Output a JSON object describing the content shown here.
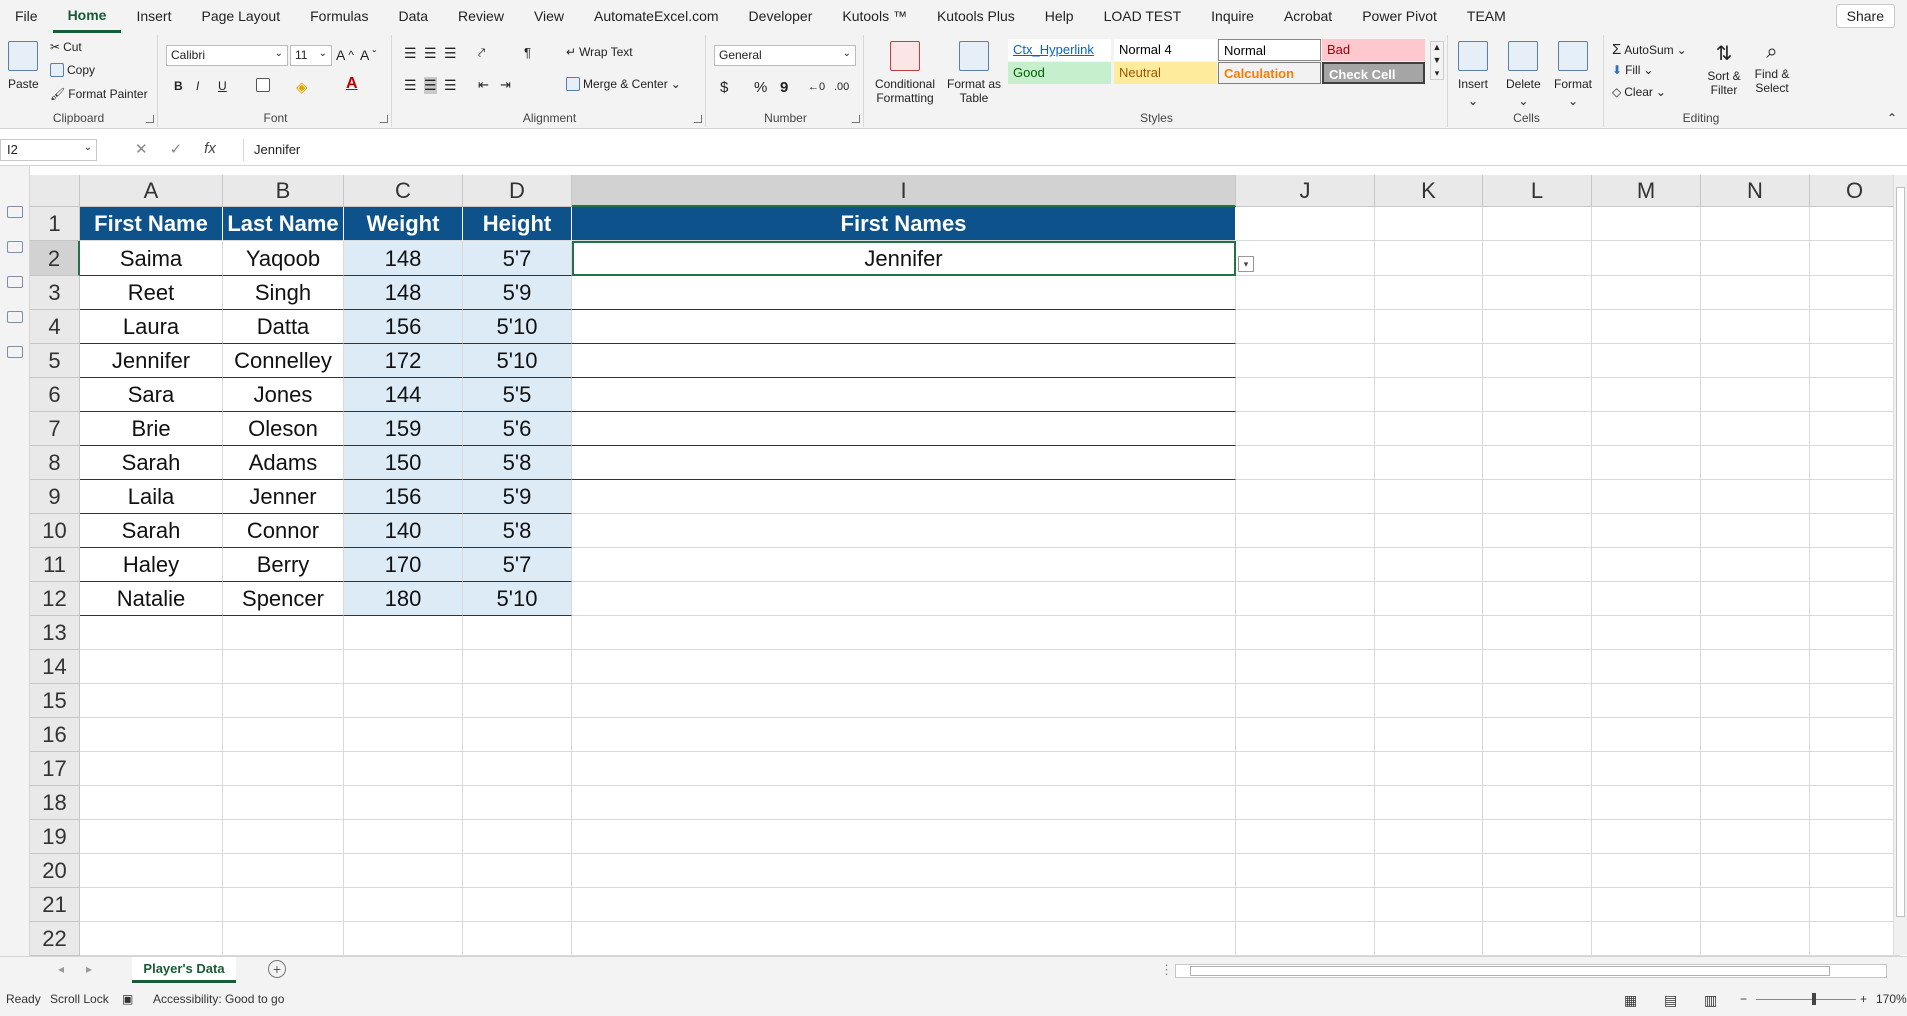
{
  "menu": {
    "tabs": [
      "File",
      "Home",
      "Insert",
      "Page Layout",
      "Formulas",
      "Data",
      "Review",
      "View",
      "AutomateExcel.com",
      "Developer",
      "Kutools ™",
      "Kutools Plus",
      "Help",
      "LOAD TEST",
      "Inquire",
      "Acrobat",
      "Power Pivot",
      "TEAM"
    ],
    "active": "Home",
    "share": "Share"
  },
  "ribbon": {
    "clipboard": {
      "label": "Clipboard",
      "paste": "Paste",
      "cut": "Cut",
      "copy": "Copy",
      "format_painter": "Format Painter"
    },
    "font": {
      "label": "Font",
      "name": "Calibri",
      "size": "11",
      "bold": "B",
      "italic": "I",
      "underline": "U"
    },
    "alignment": {
      "label": "Alignment",
      "wrap": "Wrap Text",
      "merge": "Merge & Center"
    },
    "number": {
      "label": "Number",
      "format": "General"
    },
    "styles": {
      "label": "Styles",
      "conditional": "Conditional Formatting",
      "format_table": "Format as Table",
      "cells": [
        {
          "text": "Ctx_Hyperlink",
          "bg": "#ffffff",
          "fg": "#0563c1"
        },
        {
          "text": "Normal 4",
          "bg": "#ffffff",
          "fg": "#000000"
        },
        {
          "text": "Normal",
          "bg": "#ffffff",
          "fg": "#000000"
        },
        {
          "text": "Bad",
          "bg": "#ffc7ce",
          "fg": "#9c0006"
        },
        {
          "text": "Good",
          "bg": "#c6efce",
          "fg": "#006100"
        },
        {
          "text": "Neutral",
          "bg": "#ffeb9c",
          "fg": "#9c5700"
        },
        {
          "text": "Calculation",
          "bg": "#f2f2f2",
          "fg": "#fa7d00"
        },
        {
          "text": "Check Cell",
          "bg": "#a5a5a5",
          "fg": "#ffffff"
        }
      ]
    },
    "cells": {
      "label": "Cells",
      "insert": "Insert",
      "delete": "Delete",
      "format": "Format"
    },
    "editing": {
      "label": "Editing",
      "autosum": "AutoSum",
      "fill": "Fill",
      "clear": "Clear",
      "sort": "Sort & Filter",
      "find": "Find & Select"
    }
  },
  "formula_bar": {
    "name_box": "I2",
    "value": "Jennifer",
    "fx": "fx"
  },
  "columns": [
    "A",
    "B",
    "C",
    "D",
    "I",
    "J",
    "K",
    "L",
    "M",
    "N",
    "O"
  ],
  "rows": [
    "1",
    "2",
    "3",
    "4",
    "5",
    "6",
    "7",
    "8",
    "9",
    "10",
    "11",
    "12",
    "13",
    "14",
    "15",
    "16",
    "17",
    "18",
    "19",
    "20",
    "21",
    "22"
  ],
  "table": {
    "headers": [
      "First Name",
      "Last Name",
      "Weight",
      "Height"
    ],
    "data": [
      [
        "Saima",
        "Yaqoob",
        "148",
        "5'7"
      ],
      [
        "Reet",
        "Singh",
        "148",
        "5'9"
      ],
      [
        "Laura",
        "Datta",
        "156",
        "5'10"
      ],
      [
        "Jennifer",
        "Connelley",
        "172",
        "5'10"
      ],
      [
        "Sara",
        "Jones",
        "144",
        "5'5"
      ],
      [
        "Brie",
        "Oleson",
        "159",
        "5'6"
      ],
      [
        "Sarah",
        "Adams",
        "150",
        "5'8"
      ],
      [
        "Laila",
        "Jenner",
        "156",
        "5'9"
      ],
      [
        "Sarah",
        "Connor",
        "140",
        "5'8"
      ],
      [
        "Haley",
        "Berry",
        "170",
        "5'7"
      ],
      [
        "Natalie",
        "Spencer",
        "180",
        "5'10"
      ]
    ]
  },
  "side_table": {
    "header": "First Names",
    "value": "Jennifer"
  },
  "sheet_tab": "Player's Data",
  "status": {
    "ready": "Ready",
    "scroll_lock": "Scroll Lock",
    "accessibility": "Accessibility: Good to go",
    "zoom": "170%"
  },
  "colors": {
    "header_bg": "#0d528a",
    "band_bg": "#ddebf7",
    "accent": "#185c37"
  }
}
